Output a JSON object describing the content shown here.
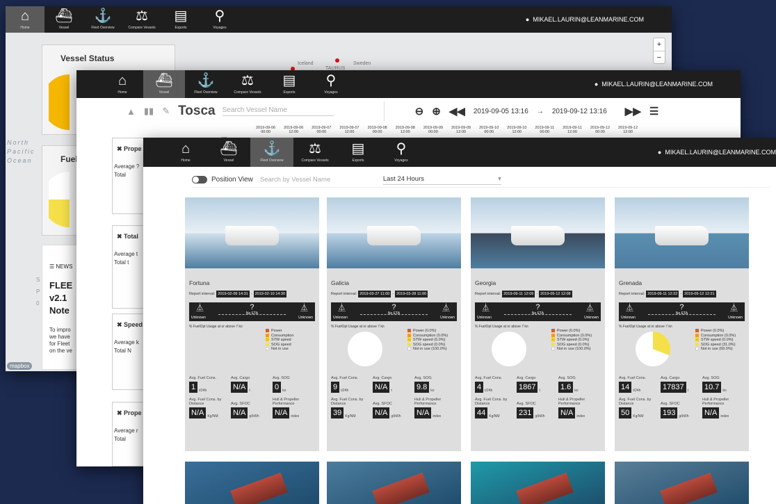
{
  "nav": [
    {
      "icon": "⌂",
      "label": "Home"
    },
    {
      "icon": "⛴",
      "label": "Vessel"
    },
    {
      "icon": "⚓",
      "label": "Fleet Overview"
    },
    {
      "icon": "⚖",
      "label": "Compare Vessels"
    },
    {
      "icon": "▤",
      "label": "Exports"
    },
    {
      "icon": "⚲",
      "label": "Voyages"
    }
  ],
  "user": "MIKAEL.LAURIN@LEANMARINE.COM",
  "back_window": {
    "vessel_status_title": "Vessel Status",
    "fuel_title": "Fuel",
    "ocean_label": [
      "North",
      "Pacific",
      "Ocean"
    ],
    "map_labels": {
      "iceland": "Iceland",
      "sweden": "Sweden",
      "taurus": "TAURUS"
    },
    "zoom_in": "+",
    "zoom_out": "−",
    "news_header": "NEWS",
    "news_title": [
      "FLEE",
      "v2.1",
      "Note"
    ],
    "news_body": [
      "To impro",
      "we have",
      "for Fleet",
      "on the ve"
    ],
    "news_side": [
      "S",
      "P",
      "0"
    ],
    "mapbox": "mapbox"
  },
  "middle_window": {
    "vessel_name": "Tosca",
    "search_placeholder": "Search Vessel Name",
    "date_from": "2019-09-05 13:16",
    "arrow": "→",
    "date_to": "2019-09-12 13:16",
    "y_tick": "100",
    "timeline": [
      [
        "2019-09-06",
        "00:00"
      ],
      [
        "2019-09-06",
        "12:00"
      ],
      [
        "2019-09-07",
        "00:00"
      ],
      [
        "2019-09-07",
        "12:00"
      ],
      [
        "2019-09-08",
        "00:00"
      ],
      [
        "2019-09-08",
        "12:00"
      ],
      [
        "2019-09-09",
        "00:00"
      ],
      [
        "2019-09-09",
        "12:00"
      ],
      [
        "2019-09-10",
        "00:00"
      ],
      [
        "2019-09-10",
        "12:00"
      ],
      [
        "2019-09-11",
        "00:00"
      ],
      [
        "2019-09-11",
        "12:00"
      ],
      [
        "2019-09-12",
        "00:00"
      ],
      [
        "2019-09-12",
        "12:00"
      ]
    ],
    "panels": [
      {
        "title": "Prope",
        "lines": [
          "Average ?",
          "Total"
        ]
      },
      {
        "title": "Total",
        "lines": [
          "Average t",
          "Total    t"
        ]
      },
      {
        "title": "Speed",
        "lines": [
          "Average k",
          "Total    N"
        ]
      },
      {
        "title": "Prope",
        "lines": [
          "Average r",
          "Total"
        ]
      }
    ]
  },
  "fleet": {
    "position_view": "Position View",
    "search_placeholder": "Search by Vessel Name",
    "period": "Last 24 Hours",
    "labels": {
      "report_interval": "Report interval:",
      "usage_title": "% FuelOpt Usage at or above 7 kn",
      "avg_fuel": "Avg. Fuel Cons.",
      "avg_cargo": "Avg. Cargo",
      "avg_sog": "Avg. SOG",
      "fuel_dist": "Avg. Fuel Cons. by Distance",
      "sfoc": "Avg. SFOC",
      "hull": "Hull & Propeller Performance",
      "unit_fuel": "t/24h",
      "unit_cargo": "t",
      "unit_sog": "kn",
      "unit_dist": "Kg/NM",
      "unit_sfoc": "g/kWh",
      "unit_index": "index",
      "unknown": "Unknown",
      "no_eta": "No ETA"
    },
    "vessels": [
      {
        "name": "Fortuna",
        "from": "2019-02-09 14:31",
        "to": "2019-02-10 14:30",
        "legend": [
          "Power",
          "Consumption",
          "STW speed",
          "SOG speed",
          "Not in use"
        ],
        "pie_pct": null,
        "fuel": "1",
        "cargo": "N/A",
        "sog": "0",
        "dist": "N/A",
        "sfoc": "N/A",
        "hull": "N/A"
      },
      {
        "name": "Galicia",
        "from": "2019-03-27 11:00",
        "to": "2019-03-28 11:00",
        "legend": [
          "Power (0.0%)",
          "Consumption (0.0%)",
          "STW speed (0.0%)",
          "SOG speed (0.0%)",
          "Not in use (100.0%)"
        ],
        "pie_pct": 0,
        "fuel": "9",
        "cargo": "N/A",
        "sog": "9.8",
        "dist": "39",
        "sfoc": "N/A",
        "hull": "N/A"
      },
      {
        "name": "Georgia",
        "from": "2019-09-11 12:09",
        "to": "2019-09-12 12:08",
        "legend": [
          "Power (0.0%)",
          "Consumption (0.0%)",
          "STW speed (0.0%)",
          "SOG speed (0.0%)",
          "Not in use (100.0%)"
        ],
        "pie_pct": 0,
        "fuel": "4",
        "cargo": "1867",
        "sog": "1.6",
        "dist": "44",
        "sfoc": "231",
        "hull": "N/A"
      },
      {
        "name": "Grenada",
        "from": "2019-09-11 12:22",
        "to": "2019-09-12 12:21",
        "legend": [
          "Power (0.0%)",
          "Consumption (0.0%)",
          "STW speed (0.0%)",
          "SOG speed (31.0%)",
          "Not in use (69.0%)"
        ],
        "pie_pct": 31,
        "fuel": "14",
        "cargo": "17837",
        "sog": "10.7",
        "dist": "50",
        "sfoc": "193",
        "hull": "N/A"
      }
    ],
    "colors": {
      "power": "#e8591a",
      "consumption": "#f29a1b",
      "stw": "#f5c518",
      "sog": "#f6e04a",
      "not_in_use": "#ffffff"
    }
  }
}
